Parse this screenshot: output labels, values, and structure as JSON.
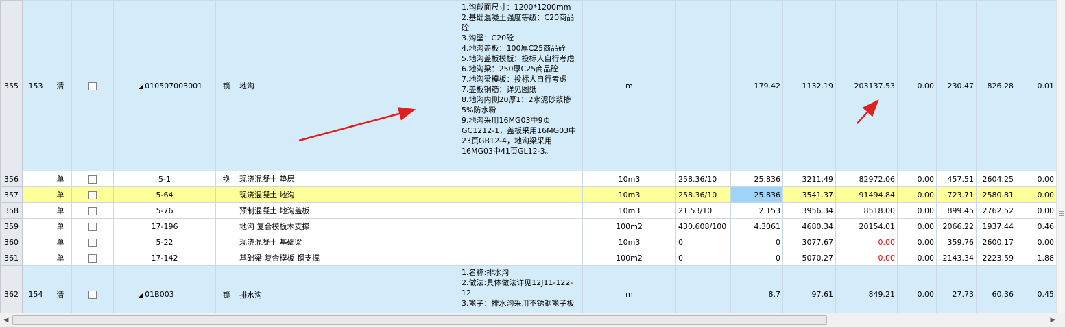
{
  "rows": [
    {
      "rownum": "355",
      "seq": "153",
      "type": "清",
      "code": "010507003001",
      "lock": "锁",
      "name": "地沟",
      "desc_lines": [
        "1.沟截面尺寸：1200*1200mm",
        "2.基础混凝土强度等级：C20商品砼",
        "3.沟壁：C20砼",
        "4.地沟盖板：100厚C25商品砼",
        "5.地沟盖板模板：投标人自行考虑",
        "6.地沟梁：250厚C25商品砼",
        "7.地沟梁模板：投标人自行考虑",
        "7.盖板钢筋：详见图纸",
        "8.地沟内侧20厚1：2水泥砂浆掺5%防水粉",
        "9.地沟采用16MG03中9页GC1212-1，盖板采用16MG03中23页GB12-4，地沟梁采用16MG03中41页GL12-3。"
      ],
      "unit": "m",
      "expr": "",
      "qty": "179.42",
      "price": "1132.19",
      "total": "203137.53",
      "c1": "0.00",
      "c2": "230.47",
      "c3": "826.28",
      "c4": "0.01"
    },
    {
      "rownum": "356",
      "seq": "",
      "type": "单",
      "code": "5-1",
      "lock": "换",
      "name": "现浇混凝土 垫层",
      "unit": "10m3",
      "expr": "258.36/10",
      "qty": "25.836",
      "price": "3211.49",
      "total": "82972.06",
      "c1": "0.00",
      "c2": "457.51",
      "c3": "2604.25",
      "c4": "0.00"
    },
    {
      "rownum": "357",
      "seq": "",
      "type": "单",
      "code": "5-64",
      "lock": "",
      "name": "现浇混凝土 地沟",
      "unit": "10m3",
      "expr": "258.36/10",
      "qty": "25.836",
      "price": "3541.37",
      "total": "91494.84",
      "c1": "0.00",
      "c2": "723.71",
      "c3": "2580.81",
      "c4": "0.00"
    },
    {
      "rownum": "358",
      "seq": "",
      "type": "单",
      "code": "5-76",
      "lock": "",
      "name": "预制混凝土 地沟盖板",
      "unit": "10m3",
      "expr": "21.53/10",
      "qty": "2.153",
      "price": "3956.34",
      "total": "8518.00",
      "c1": "0.00",
      "c2": "899.45",
      "c3": "2762.52",
      "c4": "0.00"
    },
    {
      "rownum": "359",
      "seq": "",
      "type": "单",
      "code": "17-196",
      "lock": "",
      "name": "地沟 复合模板木支撑",
      "unit": "100m2",
      "expr": "430.608/100",
      "qty": "4.3061",
      "price": "4680.34",
      "total": "20154.01",
      "c1": "0.00",
      "c2": "2066.22",
      "c3": "1937.44",
      "c4": "0.46"
    },
    {
      "rownum": "360",
      "seq": "",
      "type": "单",
      "code": "5-22",
      "lock": "",
      "name": "现浇混凝土 基础梁",
      "unit": "10m3",
      "expr": "0",
      "qty": "0",
      "price": "3077.67",
      "total": "0.00",
      "c1": "0.00",
      "c2": "359.76",
      "c3": "2600.17",
      "c4": "0.00"
    },
    {
      "rownum": "361",
      "seq": "",
      "type": "单",
      "code": "17-142",
      "lock": "",
      "name": "基础梁 复合模板 钢支撑",
      "unit": "100m2",
      "expr": "0",
      "qty": "0",
      "price": "5070.27",
      "total": "0.00",
      "c1": "0.00",
      "c2": "2143.34",
      "c3": "2223.59",
      "c4": "1.88"
    },
    {
      "rownum": "362",
      "seq": "154",
      "type": "清",
      "code": "01B003",
      "lock": "锁",
      "name": "排水沟",
      "desc_lines": [
        "1.名称:排水沟",
        "2.做法:具体做法详见12J11-122-12",
        "3.篦子：排水沟采用不锈钢篦子板"
      ],
      "unit": "m",
      "expr": "",
      "qty": "8.7",
      "price": "97.61",
      "total": "849.21",
      "c1": "0.00",
      "c2": "27.73",
      "c3": "60.36",
      "c4": "0.45"
    }
  ],
  "colors": {
    "qing_row": "#d4ecf9",
    "highlight_row": "#ffff99",
    "selected_cell": "#9fd3f7",
    "zero_total_text": "#e00000",
    "annotation_arrow": "#e02020"
  },
  "icons": [
    "expand-triangle-icon",
    "checkbox-icon",
    "scroll-left-icon",
    "scroll-right-icon"
  ]
}
